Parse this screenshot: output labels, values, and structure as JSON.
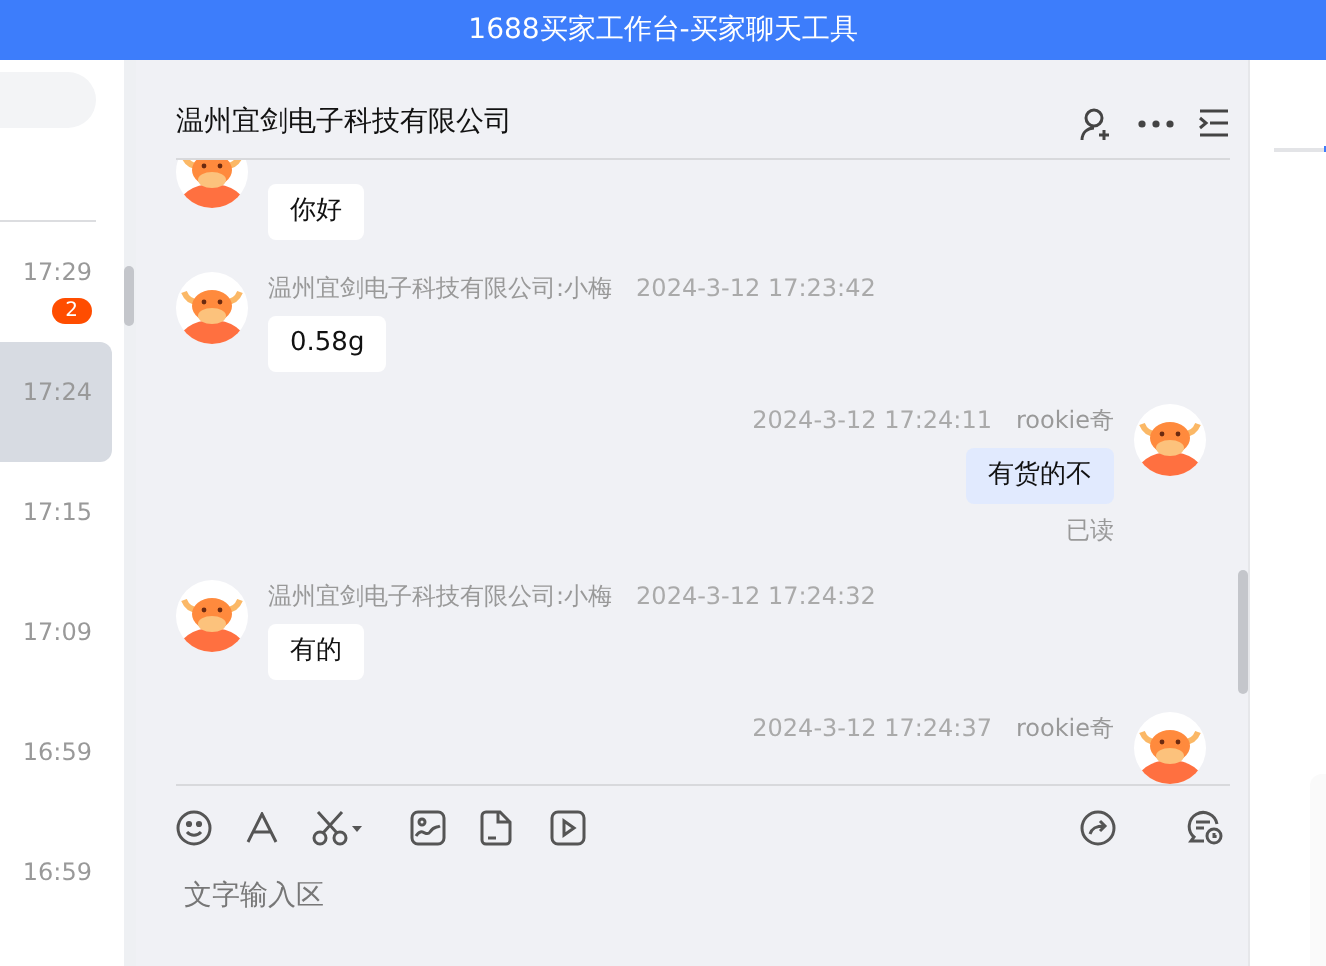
{
  "window": {
    "title": "1688买家工作台-买家聊天工具"
  },
  "conversations": [
    {
      "time": "17:29",
      "unread": "2",
      "selected": false
    },
    {
      "time": "17:24",
      "selected": true
    },
    {
      "time": "17:15",
      "selected": false
    },
    {
      "time": "17:09",
      "selected": false
    },
    {
      "time": "16:59",
      "selected": false
    },
    {
      "time": "16:59",
      "selected": false
    }
  ],
  "chat": {
    "title": "温州宜剑电子科技有限公司",
    "messages": [
      {
        "kind": "incoming",
        "text": "你好"
      },
      {
        "kind": "incoming",
        "sender": "温州宜剑电子科技有限公司:小梅",
        "time": "2024-3-12 17:23:42",
        "text": "0.58g"
      },
      {
        "kind": "outgoing",
        "sender": "rookie奇",
        "time": "2024-3-12 17:24:11",
        "text": "有货的不",
        "status": "已读"
      },
      {
        "kind": "incoming",
        "sender": "温州宜剑电子科技有限公司:小梅",
        "time": "2024-3-12 17:24:32",
        "text": "有的"
      },
      {
        "kind": "outgoing",
        "sender": "rookie奇",
        "time": "2024-3-12 17:24:37"
      }
    ],
    "input": {
      "placeholder": "文字输入区"
    }
  }
}
